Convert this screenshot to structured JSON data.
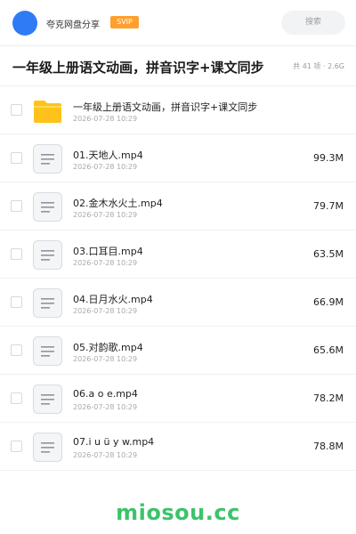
{
  "header": {
    "app_name": "夸克网盘分享",
    "vip_badge": "SVIP",
    "search_placeholder": "搜索"
  },
  "title_bar": {
    "title": "一年级上册语文动画，拼音识字+课文同步",
    "meta": "共 41 项 · 2.6G"
  },
  "files": [
    {
      "name": "一年级上册语文动画，拼音识字+课文同步",
      "date": "2026-07-28 10:29",
      "size": "",
      "icon": "folder-icon"
    },
    {
      "name": "01.天地人.mp4",
      "date": "2026-07-28 10:29",
      "size": "99.3M",
      "icon": "video-file-icon"
    },
    {
      "name": "02.金木水火土.mp4",
      "date": "2026-07-28 10:29",
      "size": "79.7M",
      "icon": "video-file-icon"
    },
    {
      "name": "03.口耳目.mp4",
      "date": "2026-07-28 10:29",
      "size": "63.5M",
      "icon": "video-file-icon"
    },
    {
      "name": "04.日月水火.mp4",
      "date": "2026-07-28 10:29",
      "size": "66.9M",
      "icon": "video-file-icon"
    },
    {
      "name": "05.对韵歌.mp4",
      "date": "2026-07-28 10:29",
      "size": "65.6M",
      "icon": "video-file-icon"
    },
    {
      "name": "06.a o e.mp4",
      "date": "2026-07-28 10:29",
      "size": "78.2M",
      "icon": "video-file-icon"
    },
    {
      "name": "07.i u ü y w.mp4",
      "date": "2026-07-28 10:29",
      "size": "78.8M",
      "icon": "video-file-icon"
    }
  ],
  "watermark": "miosou.cc",
  "colors": {
    "avatar": "#2f7bf6",
    "vip_badge": "#ff9f2e",
    "folder": "#ffc21a",
    "watermark": "#3cc36a"
  }
}
